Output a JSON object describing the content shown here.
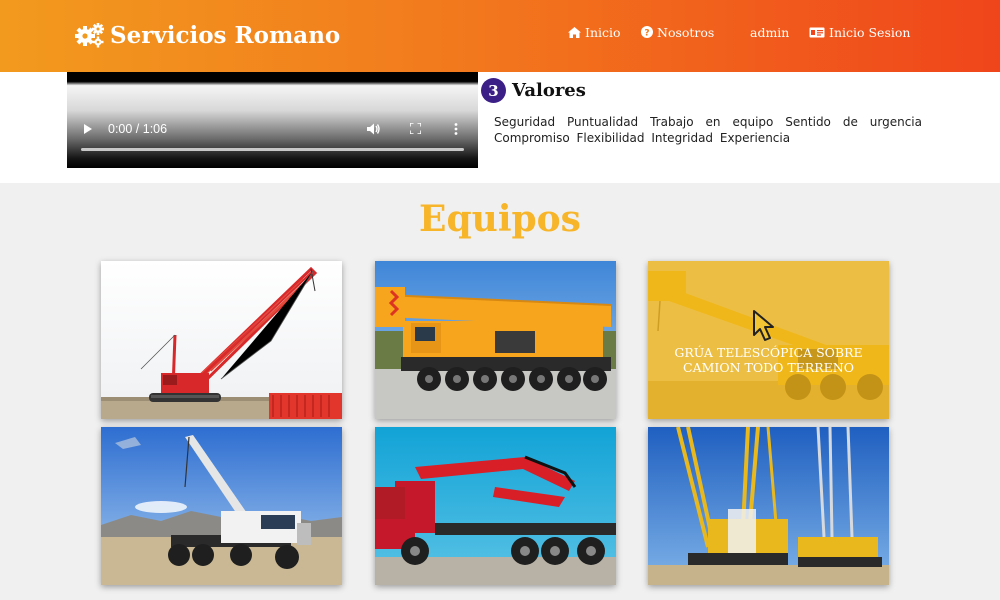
{
  "brand": {
    "name": "Servicios Romano",
    "icon": "gears-icon"
  },
  "nav": {
    "inicio": {
      "label": "Inicio",
      "icon": "home-icon"
    },
    "nosotros": {
      "label": "Nosotros",
      "icon": "question-circle-icon"
    },
    "user": {
      "label": "admin"
    },
    "login": {
      "label": "Inicio Sesion",
      "icon": "id-card-icon"
    }
  },
  "video": {
    "time": "0:00 / 1:06",
    "progress": 0
  },
  "valores": {
    "number": "3",
    "title": "Valores",
    "text": "Seguridad Puntualidad Trabajo en equipo Sentido de urgencia Compromiso Flexibilidad Integridad Experiencia"
  },
  "equipos": {
    "title": "Equipos",
    "items": [
      {
        "image": "red-crawler-crane"
      },
      {
        "image": "orange-all-terrain-crane"
      },
      {
        "image": "yellow-telescopic-crane",
        "hover_label": "GRÚA TELESCÓPICA SOBRE CAMION TODO TERRENO"
      },
      {
        "image": "white-boom-truck"
      },
      {
        "image": "red-knuckle-boom-truck"
      },
      {
        "image": "yellow-lattice-crawler-cranes"
      }
    ]
  },
  "colors": {
    "nav_start": "#f29a1e",
    "nav_end": "#f0451b",
    "accent_title": "#f7b52a",
    "badge": "#3b1f87",
    "overlay": "#f0b414"
  }
}
